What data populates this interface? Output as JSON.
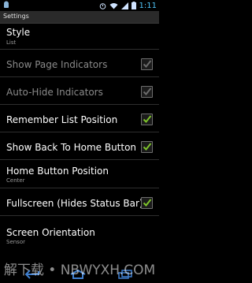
{
  "status_bar": {
    "time": "1:11",
    "left_icon": "android-icon",
    "icons": [
      "alarm-icon",
      "wifi-icon",
      "signal-icon",
      "battery-icon"
    ]
  },
  "title_bar": {
    "title": "Settings"
  },
  "settings": [
    {
      "label": "Style",
      "summary": "List"
    },
    {
      "label": "Show Page Indicators",
      "checked": true,
      "enabled": false
    },
    {
      "label": "Auto-Hide Indicators",
      "checked": true,
      "enabled": false
    },
    {
      "label": "Remember List Position",
      "checked": true,
      "enabled": true
    },
    {
      "label": "Show Back To Home Button",
      "checked": true,
      "enabled": true
    },
    {
      "label": "Home Button Position",
      "summary": "Center"
    },
    {
      "label": "Fullscreen (Hides Status Bar)",
      "checked": true,
      "enabled": true
    },
    {
      "label": "Screen Orientation",
      "summary": "Sensor"
    }
  ],
  "watermark": "解下载 • NBWYXH.COM",
  "colors": {
    "accent": "#4fc3f7",
    "check_enabled": "#7ec42a",
    "check_disabled": "#6b6b6b"
  }
}
